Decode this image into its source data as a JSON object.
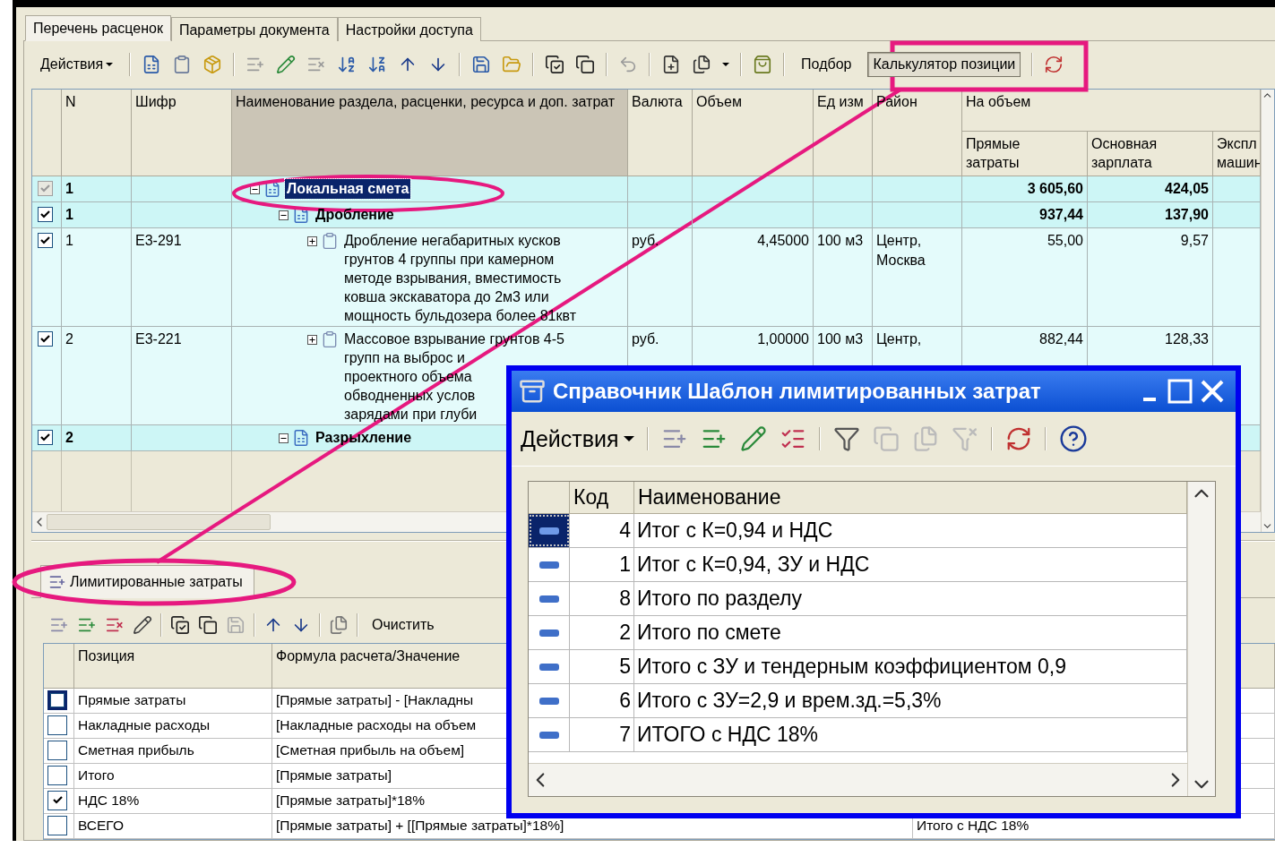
{
  "tabs": [
    {
      "label": "Перечень расценок",
      "selected": true
    },
    {
      "label": "Параметры документа",
      "selected": false
    },
    {
      "label": "Настройки доступа",
      "selected": false
    }
  ],
  "toolbar": {
    "actions": "Действия",
    "buttons": [
      {
        "label": "Подбор",
        "pressed": false
      },
      {
        "label": "Калькулятор позиции",
        "pressed": true
      }
    ]
  },
  "table": {
    "columns": [
      {
        "label": "N",
        "selected": false
      },
      {
        "label": "Шифр",
        "selected": false
      },
      {
        "label": "Наименование раздела, расценки, ресурса и доп. затрат",
        "selected": true
      },
      {
        "label": "Валюта",
        "selected": false
      },
      {
        "label": "Объем",
        "selected": false
      },
      {
        "label": "Ед изм",
        "selected": false
      },
      {
        "label": "Район",
        "selected": false
      }
    ],
    "group": {
      "label": "На объем",
      "columns": [
        "Прямые затраты",
        "Основная зарплата",
        "Экспл машин"
      ]
    },
    "rows": [
      {
        "kind": "section",
        "checked": true,
        "disabled": true,
        "selected": true,
        "expanded": true,
        "n": "1",
        "name_lines": [
          "Локальная смета"
        ],
        "direct": "3 605,60",
        "salary": "424,05",
        "children": [
          {
            "kind": "section",
            "checked": true,
            "disabled": false,
            "selected": false,
            "expanded": true,
            "n": "1",
            "name_lines": [
              "Дробление"
            ],
            "direct": "937,44",
            "salary": "137,90",
            "children": [
              {
                "kind": "item",
                "checked": true,
                "disabled": false,
                "selected": false,
                "expanded": false,
                "n": "1",
                "code": "Е3-291",
                "name_lines": [
                  "Дробление негабаритных кусков",
                  "грунтов 4 группы при камерном",
                  "методе взрывания, вместимость",
                  "ковша экскаватора до 2м3 или",
                  "мощность бульдозера более 81квт"
                ],
                "currency": "руб.",
                "volume": "4,45000",
                "unit": "100 м3",
                "district": "Центр, Москва",
                "direct": "55,00",
                "salary": "9,57"
              },
              {
                "kind": "item",
                "checked": true,
                "disabled": false,
                "selected": false,
                "expanded": false,
                "n": "2",
                "code": "Е3-221",
                "name_lines": [
                  "Массовое взрывание грунтов 4-5",
                  "групп на выброс и",
                  "проектного объема",
                  "обводненных услов",
                  "зарядами при глуби"
                ],
                "currency": "руб.",
                "volume": "1,00000",
                "unit": "100 м3",
                "district": "Центр,",
                "direct": "882,44",
                "salary": "128,33"
              }
            ]
          },
          {
            "kind": "section",
            "checked": true,
            "disabled": false,
            "selected": false,
            "expanded": true,
            "n": "2",
            "name_lines": [
              "Разрыхление"
            ]
          }
        ]
      }
    ]
  },
  "limits": {
    "tab": "Лимитированные затраты",
    "clear_button": "Очистить",
    "columns": [
      "Позиция",
      "Формула расчета/Значение"
    ],
    "rows": [
      {
        "checked": false,
        "selected": true,
        "position": "Прямые затраты",
        "formula": "[Прямые затраты] - [Накладны"
      },
      {
        "checked": false,
        "selected": false,
        "position": "Накладные расходы",
        "formula": "[Накладные расходы на объем"
      },
      {
        "checked": false,
        "selected": false,
        "position": "Сметная прибыль",
        "formula": "[Сметная прибыль на объем]"
      },
      {
        "checked": false,
        "selected": false,
        "position": "Итого",
        "formula": "[Прямые затраты]"
      },
      {
        "checked": true,
        "selected": false,
        "position": "НДС 18%",
        "formula": "[Прямые затраты]*18%"
      },
      {
        "checked": false,
        "selected": false,
        "position": "ВСЕГО",
        "formula": "[Прямые затраты] +  [[Прямые затраты]*18%]",
        "column_3": "Итого с НДС 18%"
      }
    ]
  },
  "dialog": {
    "title": "Справочник Шаблон лимитированных затрат",
    "actions": "Действия",
    "columns": [
      "Код",
      "Наименование"
    ],
    "rows": [
      {
        "code": "4",
        "name": "Итог с К=0,94 и НДС",
        "selected": true
      },
      {
        "code": "1",
        "name": "Итог с К=0,94, ЗУ и НДС",
        "selected": false
      },
      {
        "code": "8",
        "name": "Итого по разделу",
        "selected": false
      },
      {
        "code": "2",
        "name": "Итого по смете",
        "selected": false
      },
      {
        "code": "5",
        "name": "Итого с ЗУ и тендерным коэффициентом 0,9",
        "selected": false
      },
      {
        "code": "6",
        "name": "Итого с ЗУ=2,9 и врем.зд.=5,3%",
        "selected": false
      },
      {
        "code": "7",
        "name": "ИТОГО с НДС 18%",
        "selected": false
      }
    ]
  }
}
